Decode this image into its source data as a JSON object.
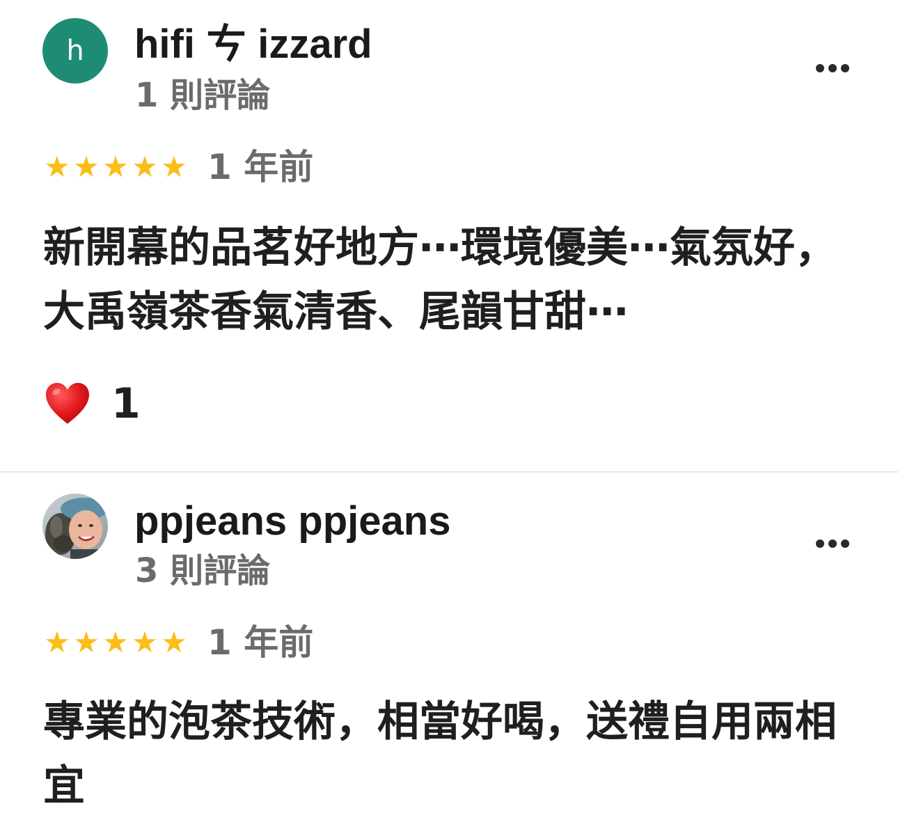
{
  "reviews": [
    {
      "avatar_letter": "h",
      "avatar_color": "#1e8c75",
      "name": "hifi ㄘ izzard",
      "review_count": "1 則評論",
      "rating": 5,
      "stars": [
        "★",
        "★",
        "★",
        "★",
        "★"
      ],
      "time": "1 年前",
      "text": "新開幕的品茗好地方⋯環境優美⋯氣氛好，大禹嶺茶香氣清香、尾韻甘甜⋯",
      "reaction": {
        "icon": "heart-icon",
        "count": "1"
      }
    },
    {
      "avatar_type": "photo",
      "name": "ppjeans ppjeans",
      "review_count": "3 則評論",
      "rating": 5,
      "stars": [
        "★",
        "★",
        "★",
        "★",
        "★"
      ],
      "time": "1 年前",
      "text": "專業的泡茶技術，相當好喝，送禮自用兩相宜"
    }
  ],
  "colors": {
    "star": "#fbbd17",
    "secondary_text": "#6b6b6b",
    "primary_text": "#1f1f1f",
    "heart": "#e0191d",
    "divider": "#e6e6e6"
  }
}
